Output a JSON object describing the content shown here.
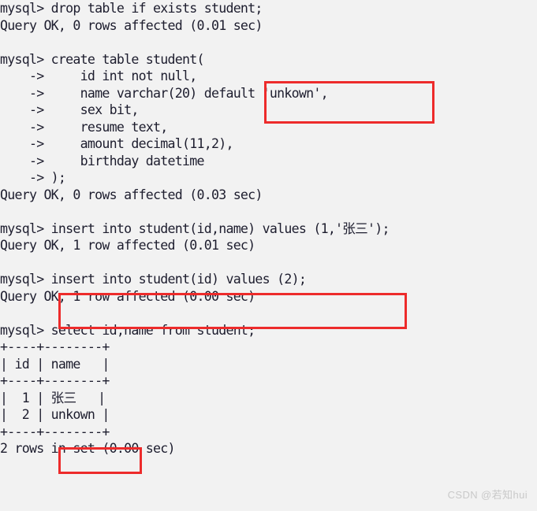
{
  "terminal": {
    "background_color": "#f2f2f2",
    "text_color": "#1d1d2e",
    "annotation_color": "#ed2b2b",
    "prompt": "mysql>",
    "continuation_prompt": "->"
  },
  "console_lines": [
    "mysql> drop table if exists student;",
    "Query OK, 0 rows affected (0.01 sec)",
    "",
    "mysql> create table student(",
    "    ->     id int not null,",
    "    ->     name varchar(20) default 'unkown',",
    "    ->     sex bit,",
    "    ->     resume text,",
    "    ->     amount decimal(11,2),",
    "    ->     birthday datetime",
    "    -> );",
    "Query OK, 0 rows affected (0.03 sec)",
    "",
    "mysql> insert into student(id,name) values (1,'张三');",
    "Query OK, 1 row affected (0.01 sec)",
    "",
    "mysql> insert into student(id) values (2);",
    "Query OK, 1 row affected (0.00 sec)",
    "",
    "mysql> select id,name from student;",
    "+----+--------+",
    "| id | name   |",
    "+----+--------+",
    "|  1 | 张三   |",
    "|  2 | unkown |",
    "+----+--------+",
    "2 rows in set (0.00 sec)"
  ],
  "statements": {
    "drop_table": "drop table if exists student;",
    "create_table": "create table student(",
    "insert_with_name": "insert into student(id,name) values (1,'张三');",
    "insert_without_name": "insert into student(id) values (2);",
    "select": "select id,name from student;"
  },
  "result_messages": {
    "drop_result": "Query OK, 0 rows affected (0.01 sec)",
    "create_result": "Query OK, 0 rows affected (0.03 sec)",
    "insert1_result": "Query OK, 1 row affected (0.01 sec)",
    "insert2_result": "Query OK, 1 row affected (0.00 sec)",
    "select_result": "2 rows in set (0.00 sec)"
  },
  "result_table": {
    "separator": "+----+--------+",
    "columns": [
      "id",
      "name"
    ],
    "rows": [
      {
        "id": "1",
        "name": "张三"
      },
      {
        "id": "2",
        "name": "unkown"
      }
    ],
    "row_count_label": "2 rows in set (0.00 sec)"
  },
  "annotations": [
    {
      "name": "default-clause-highlight",
      "text": "default 'unkown',",
      "color": "#ed2b2b"
    },
    {
      "name": "insert-statement-highlight",
      "text": "insert into student(id) values (2);",
      "color": "#ed2b2b"
    },
    {
      "name": "default-value-result-highlight",
      "text": "unkown",
      "color": "#ed2b2b"
    }
  ],
  "watermark": {
    "text": "CSDN @若知hui"
  }
}
